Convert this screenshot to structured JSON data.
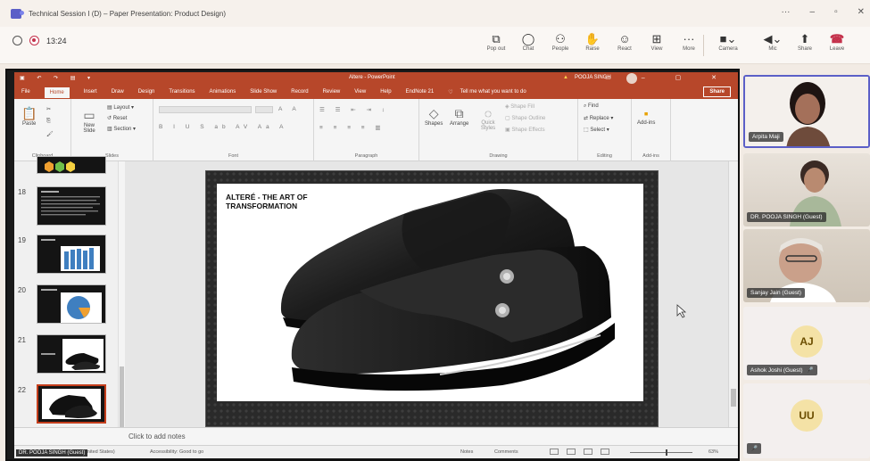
{
  "window": {
    "title": "Technical Session I (D) – Paper Presentation: Product Design)"
  },
  "meeting": {
    "time": "13:24"
  },
  "toolbar": [
    {
      "label": "Pop out",
      "icon": "popout-icon"
    },
    {
      "label": "Chat",
      "icon": "chat-icon"
    },
    {
      "label": "People",
      "icon": "people-icon"
    },
    {
      "label": "Raise",
      "icon": "raise-hand-icon"
    },
    {
      "label": "React",
      "icon": "react-icon"
    },
    {
      "label": "View",
      "icon": "view-icon"
    },
    {
      "label": "More",
      "icon": "more-icon"
    },
    {
      "label": "Camera",
      "icon": "camera-icon"
    },
    {
      "label": "Mic",
      "icon": "mic-icon"
    },
    {
      "label": "Share",
      "icon": "share-icon"
    },
    {
      "label": "Leave",
      "icon": "leave-icon"
    }
  ],
  "ppt": {
    "doc_title": "Altere - PowerPoint",
    "user": "POOJA SINGH",
    "tabs": [
      "File",
      "Home",
      "Insert",
      "Draw",
      "Design",
      "Transitions",
      "Animations",
      "Slide Show",
      "Record",
      "Review",
      "View",
      "Help",
      "EndNote 21"
    ],
    "tell_me": "Tell me what you want to do",
    "share": "Share",
    "ribbon": {
      "paste": "Paste",
      "new_slide": "New Slide",
      "layout": "Layout",
      "reset": "Reset",
      "section": "Section",
      "shapes": "Shapes",
      "arrange": "Arrange",
      "quick_styles": "Quick Styles",
      "shape_fill": "Shape Fill",
      "shape_outline": "Shape Outline",
      "shape_effects": "Shape Effects",
      "find": "Find",
      "replace": "Replace",
      "select": "Select",
      "addins": "Add-ins",
      "groups": [
        "Clipboard",
        "Slides",
        "Font",
        "Paragraph",
        "Drawing",
        "Editing",
        "Add-ins"
      ]
    },
    "thumbnails": [
      "18",
      "19",
      "20",
      "21",
      "22"
    ],
    "slide_title": "ALTERÉ - THE ART OF TRANSFORMATION",
    "notes_placeholder": "Click to add notes",
    "status": {
      "language": "(United States)",
      "accessibility": "Accessibility: Good to go",
      "notes": "Notes",
      "comments": "Comments",
      "zoom": "63%"
    },
    "presenter_tag": "DR. POOJA SINGH (Guest)"
  },
  "participants": [
    {
      "name": "Arpita Maji"
    },
    {
      "name": "DR. POOJA SINGH (Guest)"
    },
    {
      "name": "Sanjay Jain (Guest)"
    },
    {
      "name": "Ashok Joshi (Guest)",
      "initials": "AJ"
    },
    {
      "name": "",
      "initials": "UU"
    }
  ],
  "colors": {
    "ppt_accent": "#b7472a",
    "teams_accent": "#5b5fc7",
    "leave": "#c4314b"
  }
}
